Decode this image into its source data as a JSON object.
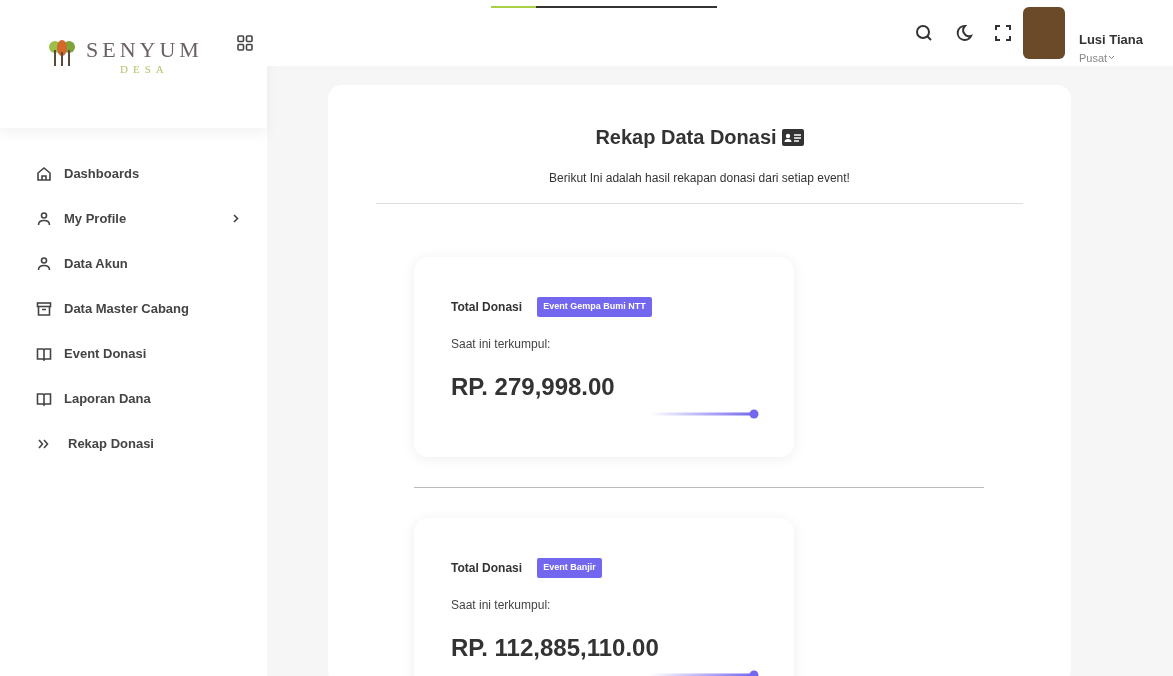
{
  "loading_bar": {
    "level": 0.2
  },
  "logo": {
    "name": "SENYUM",
    "tagline": "DESA"
  },
  "sidebar": {
    "items": [
      {
        "label": "Dashboards",
        "expandable": false
      },
      {
        "label": "My Profile",
        "expandable": true
      },
      {
        "label": "Data Akun",
        "expandable": false
      },
      {
        "label": "Data Master Cabang",
        "expandable": false
      },
      {
        "label": "Event Donasi",
        "expandable": false
      },
      {
        "label": "Laporan Dana",
        "expandable": false
      },
      {
        "label": "Rekap Donasi",
        "expandable": false
      }
    ]
  },
  "user": {
    "name": "Lusi Tiana",
    "role": "Pusat"
  },
  "page": {
    "title": "Rekap Data Donasi",
    "subtitle": "Berikut Ini adalah hasil rekapan donasi dari setiap event!"
  },
  "donations": [
    {
      "label": "Total Donasi",
      "event": "Event Gempa Bumi NTT",
      "caption": "Saat ini terkumpul:",
      "amount": "RP. 279,998.00"
    },
    {
      "label": "Total Donasi",
      "event": "Event Banjir",
      "caption": "Saat ini terkumpul:",
      "amount": "RP. 112,885,110.00"
    }
  ]
}
